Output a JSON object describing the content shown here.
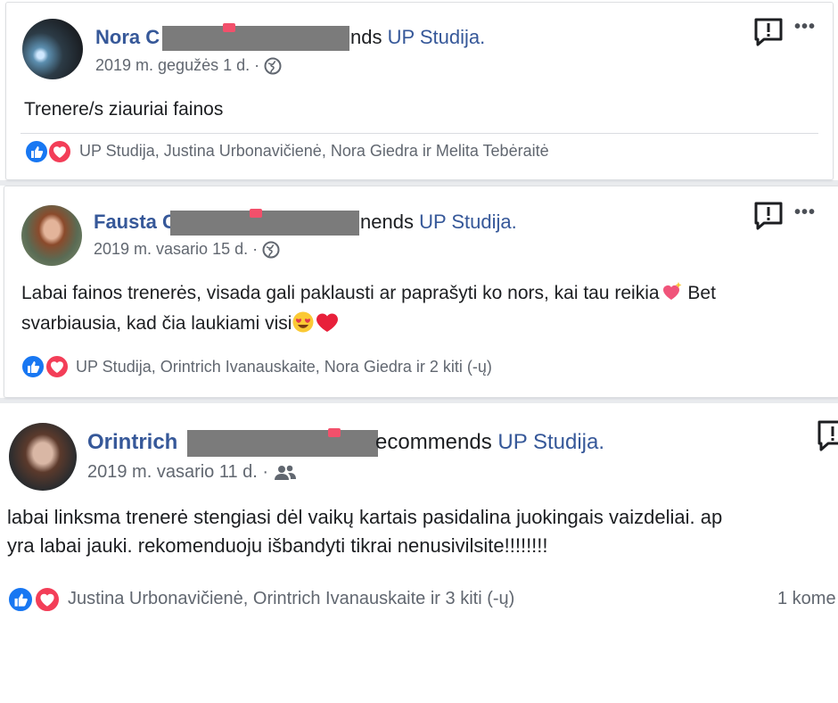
{
  "posts": [
    {
      "author": "Nora C",
      "verb_tail": "nds",
      "page": "UP Studija.",
      "date": "2019 m. gegužės 1 d. ·",
      "body_lines": [
        "Trenere/s ziauriai fainos"
      ],
      "reactions": "UP Studija, Justina Urbonavičienė, Nora Giedra ir Melita Tebėraitė",
      "audience_icon": "globe-icon"
    },
    {
      "author": "Fausta C",
      "verb_tail": "nends",
      "page": "UP Studija.",
      "date": "2019 m. vasario 15 d. ·",
      "body_lines": [
        "Labai fainos trenerės, visada gali paklausti ar paprašyti ko nors, kai tau reikia",
        "Bet",
        "svarbiausia, kad čia laukiami visi"
      ],
      "reactions": "UP Studija, Orintrich Ivanauskaite, Nora Giedra ir 2 kiti (-ų)",
      "audience_icon": "globe-icon"
    },
    {
      "author": "Orintrich",
      "verb_tail": "ecommends",
      "page": "UP Studija.",
      "date": "2019 m. vasario 11 d. ·",
      "body_lines": [
        "labai linksma trenerė stengiasi dėl vaikų kartais pasidalina juokingais vaizdeliai. ap",
        "yra labai jauki. rekomenduoju išbandyti tikrai nenusivilsite!!!!!!!!"
      ],
      "reactions": "Justina Urbonavičienė, Orintrich Ivanauskaite ir 3 kiti (-ų)",
      "comments": "1 kome",
      "audience_icon": "friends-icon"
    }
  ],
  "colors": {
    "link": "#365899",
    "like": "#1877f2",
    "love": "#f33e58",
    "meta": "#616770",
    "redaction": "#7b7b7b"
  }
}
